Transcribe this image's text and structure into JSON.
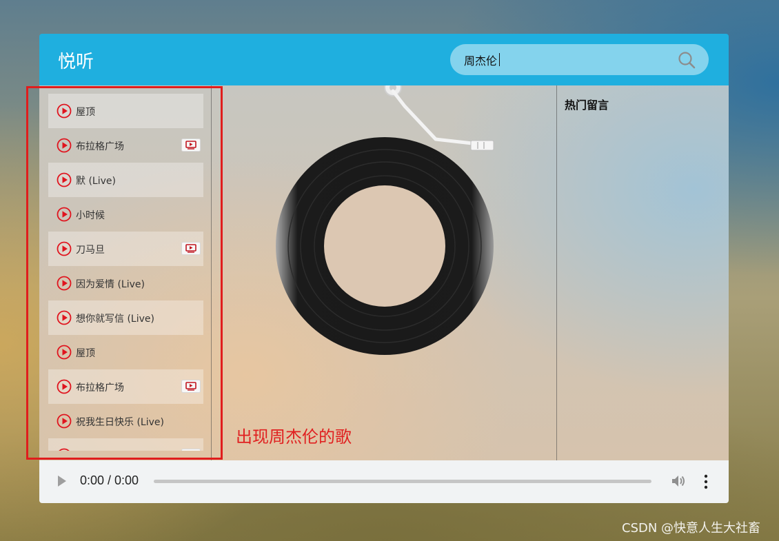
{
  "app": {
    "logo": "悦听",
    "search": {
      "value": "周杰伦",
      "placeholder": ""
    },
    "colors": {
      "header": "#1fafdf",
      "accent": "#e01d1d"
    }
  },
  "playlist": [
    {
      "name": "屋顶",
      "mv": false
    },
    {
      "name": "布拉格广场",
      "mv": true
    },
    {
      "name": "默 (Live)",
      "mv": false
    },
    {
      "name": "小时候",
      "mv": false
    },
    {
      "name": "刀马旦",
      "mv": true
    },
    {
      "name": "因为爱情 (Live)",
      "mv": false
    },
    {
      "name": "想你就写信 (Live)",
      "mv": false
    },
    {
      "name": "屋顶",
      "mv": false
    },
    {
      "name": "布拉格广场",
      "mv": true
    },
    {
      "name": "祝我生日快乐 (Live)",
      "mv": false
    },
    {
      "name": "",
      "mv": true
    }
  ],
  "comments": {
    "title": "热门留言"
  },
  "annotation": "出现周杰伦的歌",
  "audio": {
    "time": "0:00 / 0:00",
    "progress": 0
  },
  "watermark": "CSDN @快意人生大社畜",
  "icons": [
    "search-icon",
    "play-circle-icon",
    "mv-icon",
    "play-icon",
    "volume-icon",
    "more-vert-icon"
  ]
}
